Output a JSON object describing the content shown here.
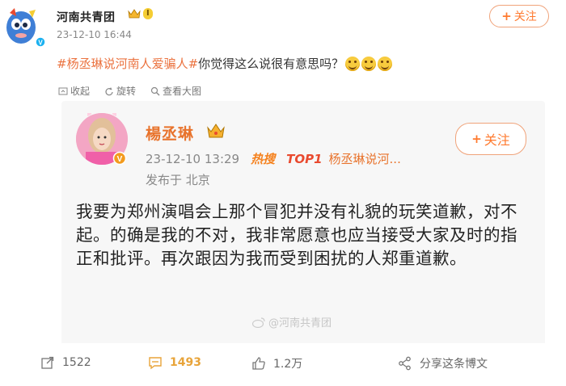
{
  "post": {
    "author": "河南共青团",
    "level": "I",
    "time": "23-12-10 16:44",
    "hashtag": "#杨丞琳说河南人爱骗人#",
    "text": "你觉得这么说很有意思吗？",
    "follow_label": "关注",
    "follow_plus": "+"
  },
  "image_actions": {
    "collect": "收起",
    "rotate": "旋转",
    "view_large": "查看大图"
  },
  "repost": {
    "author": "楊丞琳",
    "time": "23-12-10 13:29",
    "hot_tag": "热搜",
    "rank_tag": "TOP1",
    "hot_topic": "杨丞琳说河...",
    "location": "发布于 北京",
    "follow_label": "关注",
    "follow_plus": "+",
    "content": "我要为郑州演唱会上那个冒犯并没有礼貌的玩笑道歉，对不起。的确是我的不对，我非常愿意也应当接受大家及时的指正和批评。再次跟因为我而受到困扰的人郑重道歉。"
  },
  "watermark": "@河南共青团",
  "stats": {
    "reposts": "1522",
    "comments": "1493",
    "likes": "1.2万",
    "share": "分享这条博文"
  },
  "colors": {
    "accent": "#ff7a2f",
    "hashtag": "#eb7340",
    "card_bg": "#f7f7f7"
  },
  "icons": {
    "avatar_top": "cartoon-mascot-avatar",
    "verified": "verified-badge-icon",
    "crown": "crown-icon"
  }
}
